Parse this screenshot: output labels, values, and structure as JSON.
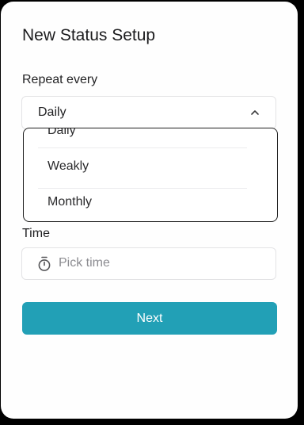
{
  "dialog": {
    "title": "New Status Setup"
  },
  "repeat": {
    "label": "Repeat every",
    "selected_value": "Daily",
    "options": [
      "Daily",
      "Weakly",
      "Monthly"
    ]
  },
  "time": {
    "label": "Time",
    "placeholder": "Pick time"
  },
  "actions": {
    "next_label": "Next"
  },
  "colors": {
    "accent": "#22a0b6",
    "dropdown_border": "#1f1f1f",
    "field_border": "#e3e3e5",
    "placeholder_text": "#8b8b90"
  },
  "icons": {
    "select_toggle": "chevron-up-icon",
    "time_field": "stopwatch-icon"
  }
}
